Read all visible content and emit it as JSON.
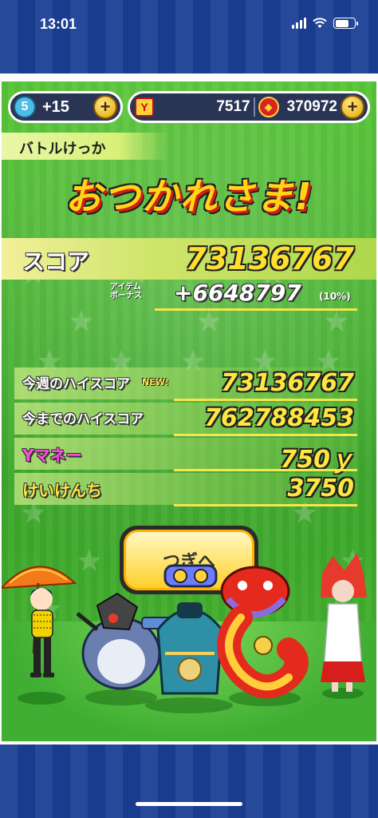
{
  "status_bar": {
    "time": "13:01"
  },
  "currency": {
    "stamina_level": "5",
    "stamina_bonus": "+15",
    "tickets": "7517",
    "coins": "370972"
  },
  "result": {
    "section_label": "バトルけっか",
    "title": "おつかれさま!",
    "score_label": "スコア",
    "score_value": "73136767",
    "bonus_label_line1": "アイテム",
    "bonus_label_line2": "ボーナス",
    "bonus_value": "+6648797",
    "bonus_percent": "(10%)"
  },
  "stats": {
    "weekly_high_label": "今週のハイスコア",
    "weekly_high_badge": "NEW!",
    "weekly_high_value": "73136767",
    "alltime_high_label": "今までのハイスコア",
    "alltime_high_value": "762788453",
    "ymoney_label": "Yマネー",
    "ymoney_value": "750ｙ",
    "exp_label": "けいけんち",
    "exp_value": "3750"
  },
  "buttons": {
    "next_label": "つぎへ"
  },
  "colors": {
    "panel_green": "#3ba52a",
    "score_yellow": "#ffdf2e",
    "title_red": "#d31f10",
    "nav_blue": "#1a3f95"
  }
}
